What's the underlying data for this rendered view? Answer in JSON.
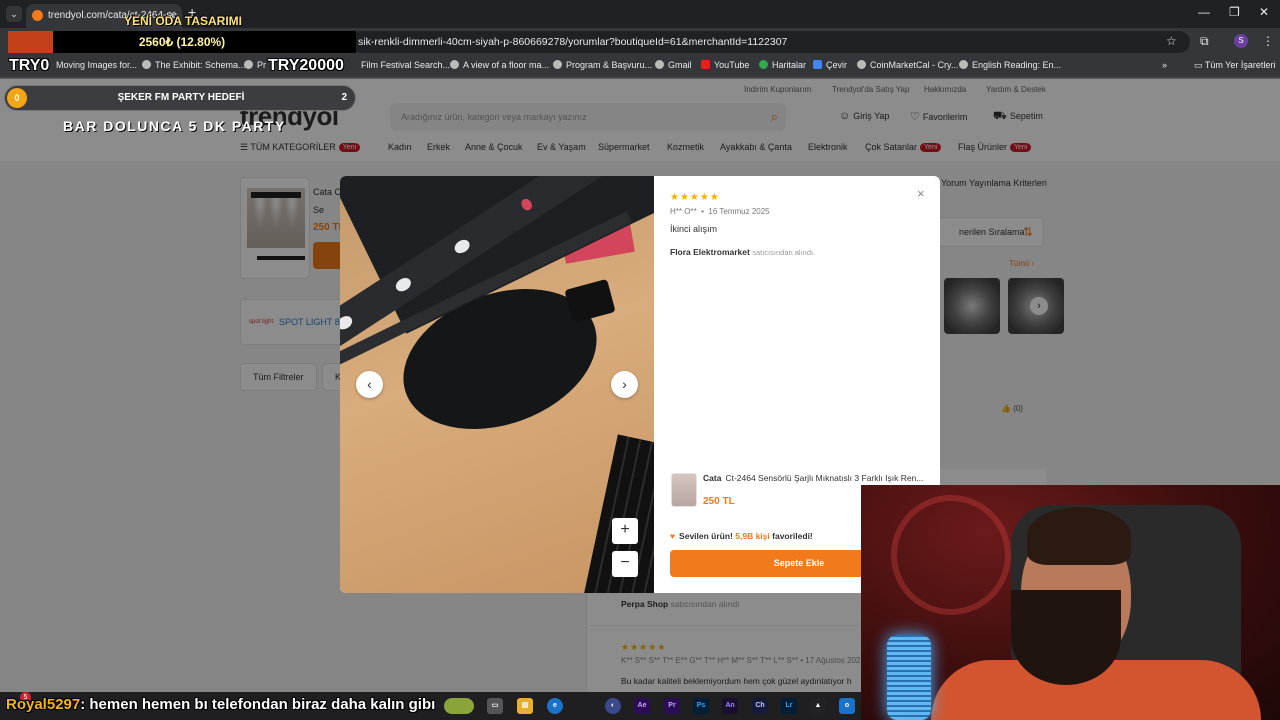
{
  "browser": {
    "tab_title": "trendyol.com/cata/ct-2464-se",
    "url": "sik-renkli-dimmerli-40cm-siyah-p-860669278/yorumlar?boutiqueId=61&merchantId=1122307",
    "bookmarks": [
      "Moving Images for...",
      "The Exhibit: Schema...",
      "Pr",
      "Film Festival Search...",
      "A view of a floor ma...",
      "Program & Başvuru...",
      "Gmail",
      "YouTube",
      "Haritalar",
      "Çevir",
      "CoinMarketCal - Cry...",
      "English Reading: En..."
    ],
    "all_bookmarks": "Tüm Yer İşaretleri",
    "profile_initial": "S"
  },
  "site": {
    "top_links": [
      "İndirim Kuponlarım",
      "Trendyol'da Satış Yap",
      "Hakkımızda",
      "Yardım & Destek"
    ],
    "logo": "trendyol",
    "search_placeholder": "Aradığınız ürün, kategori veya markayı yazınız",
    "login": "Giriş Yap",
    "favorites": "Favorilerim",
    "cart": "Sepetim",
    "all_categories": "TÜM KATEGORİLER",
    "yeni": "Yeni",
    "nav": [
      "Kadın",
      "Erkek",
      "Anne & Çocuk",
      "Ev & Yaşam",
      "Süpermarket",
      "Kozmetik",
      "Ayakkabı & Çanta",
      "Elektronik",
      "Çok Satanlar",
      "Flaş Ürünler"
    ]
  },
  "background": {
    "product_brand": "Cata C",
    "product_line2": "Se",
    "product_price": "250 TL",
    "spot_light": "SPOT LIGHT",
    "spot_logo": "spot light",
    "spot_badge": "8.4",
    "filters_all": "Tüm Filtreler",
    "filters_next": "Ko",
    "criteria": "Yorum Yayınlama Kriterleri",
    "sort": "nerilen Sıralama",
    "tumu": "Tümü",
    "likes": "(0)",
    "review2_seller": "Perpa Shop",
    "review2_seller_suffix": "satıcısından alındı",
    "review3_stars": "★★★★★",
    "review3_user": "K** S** S** T** E** G** T** H** M** S** T** L** S**  •  17 Ağustos 202",
    "review3_text": "Bu kadar kaliteli beklemiyordum hem çok güzel aydınlatıyor h"
  },
  "modal": {
    "stars": "★★★★★",
    "user": "H** O**",
    "date": "16 Temmuz 2025",
    "comment": "İkinci alışım",
    "seller": "Flora Elektromarket",
    "seller_suffix": "satıcısından alındı.",
    "product_brand": "Cata",
    "product_name": "Ct-2464 Sensörlü Şarjlı Mıknatıslı 3 Farklı Işık Ren...",
    "price": "250 TL",
    "fav_prefix": "Sevilen ürün!",
    "fav_count": "5,9B kişi",
    "fav_suffix": "favoriledi!",
    "add_to_cart": "Sepete Ekle",
    "close": "×",
    "prev": "‹",
    "next": "›",
    "zoom_in": "+",
    "zoom_out": "−"
  },
  "overlay": {
    "title": "YENİ ODA TASARIMI",
    "goal_amount": "2560₺ (12.80%)",
    "goal_progress": 0.128,
    "goal_start": "TRY0",
    "goal_end": "TRY20000",
    "party_current": "0",
    "party_label": "ŞEKER FM PARTY HEDEFİ",
    "party_max": "2",
    "party_sub": "BAR DOLUNCA 5 DK PARTY"
  },
  "chat": {
    "user": "Royal5297",
    "message": ": hemen hemen bı telefondan biraz daha kalın gibı",
    "notif_count": "5"
  },
  "taskbar": {
    "apps": [
      "Ae",
      "Pr",
      "Ps",
      "An",
      "Ch",
      "Lr"
    ]
  }
}
